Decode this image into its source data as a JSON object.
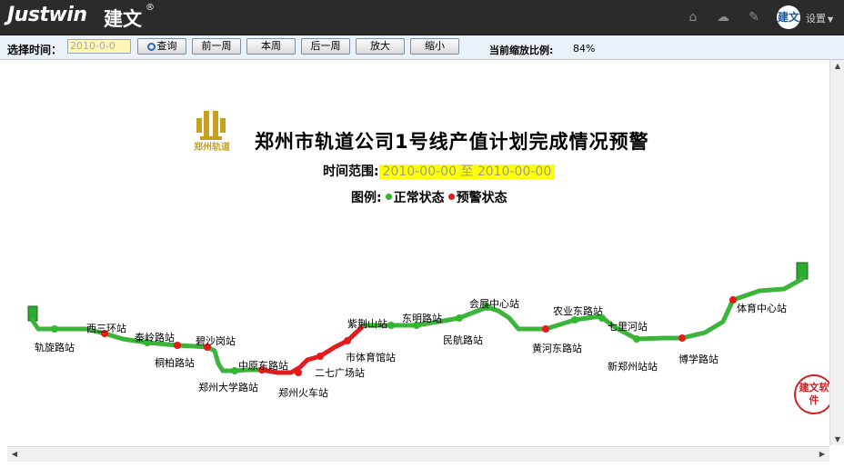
{
  "app": {
    "logo_text": "Justwin",
    "logo_cn": "建文",
    "logo_reg": "®",
    "user_avatar_text": "建文",
    "settings_label": "设置"
  },
  "toolbar": {
    "date_label": "选择时间：",
    "date_value": "2010-0-0",
    "buttons": [
      "查询",
      "前一周",
      "本周",
      "后一周",
      "放大",
      "缩小"
    ],
    "zoom_label": "当前缩放比例:",
    "zoom_value": "84%"
  },
  "report": {
    "org_logo_text": "郑州轨道",
    "title": "郑州市轨道公司1号线产值计划完成情况预警",
    "range_label": "时间范围:",
    "range_value": "2010-00-00 至 2010-00-00",
    "legend_label": "图例:",
    "legend_normal": "正常状态",
    "legend_warning": "预警状态"
  },
  "colors": {
    "normal": "#2eb82e",
    "warning": "#e81818",
    "line_green": "#3cb43c",
    "line_red": "#e21c1c"
  },
  "stations": [
    {
      "name": "轨旋路站",
      "status": "normal"
    },
    {
      "name": "西三环站",
      "status": "warning"
    },
    {
      "name": "秦岭路站",
      "status": "normal"
    },
    {
      "name": "桐柏路站",
      "status": "warning"
    },
    {
      "name": "碧沙岗站",
      "status": "warning"
    },
    {
      "name": "郑州大学路站",
      "status": "normal"
    },
    {
      "name": "中原东路站",
      "status": "warning"
    },
    {
      "name": "郑州火车站",
      "status": "warning"
    },
    {
      "name": "二七广场站",
      "status": "warning"
    },
    {
      "name": "市体育馆站",
      "status": "warning"
    },
    {
      "name": "紫荆山站",
      "status": "normal"
    },
    {
      "name": "东明路站",
      "status": "normal"
    },
    {
      "name": "民航路站",
      "status": "normal"
    },
    {
      "name": "会展中心站",
      "status": "normal"
    },
    {
      "name": "黄河东路站",
      "status": "warning"
    },
    {
      "name": "农业东路站",
      "status": "normal"
    },
    {
      "name": "七里河站",
      "status": "normal"
    },
    {
      "name": "新郑州站站",
      "status": "normal"
    },
    {
      "name": "博学路站",
      "status": "warning"
    },
    {
      "name": "体育中心站",
      "status": "warning"
    }
  ],
  "stamp_text": "建文软件"
}
